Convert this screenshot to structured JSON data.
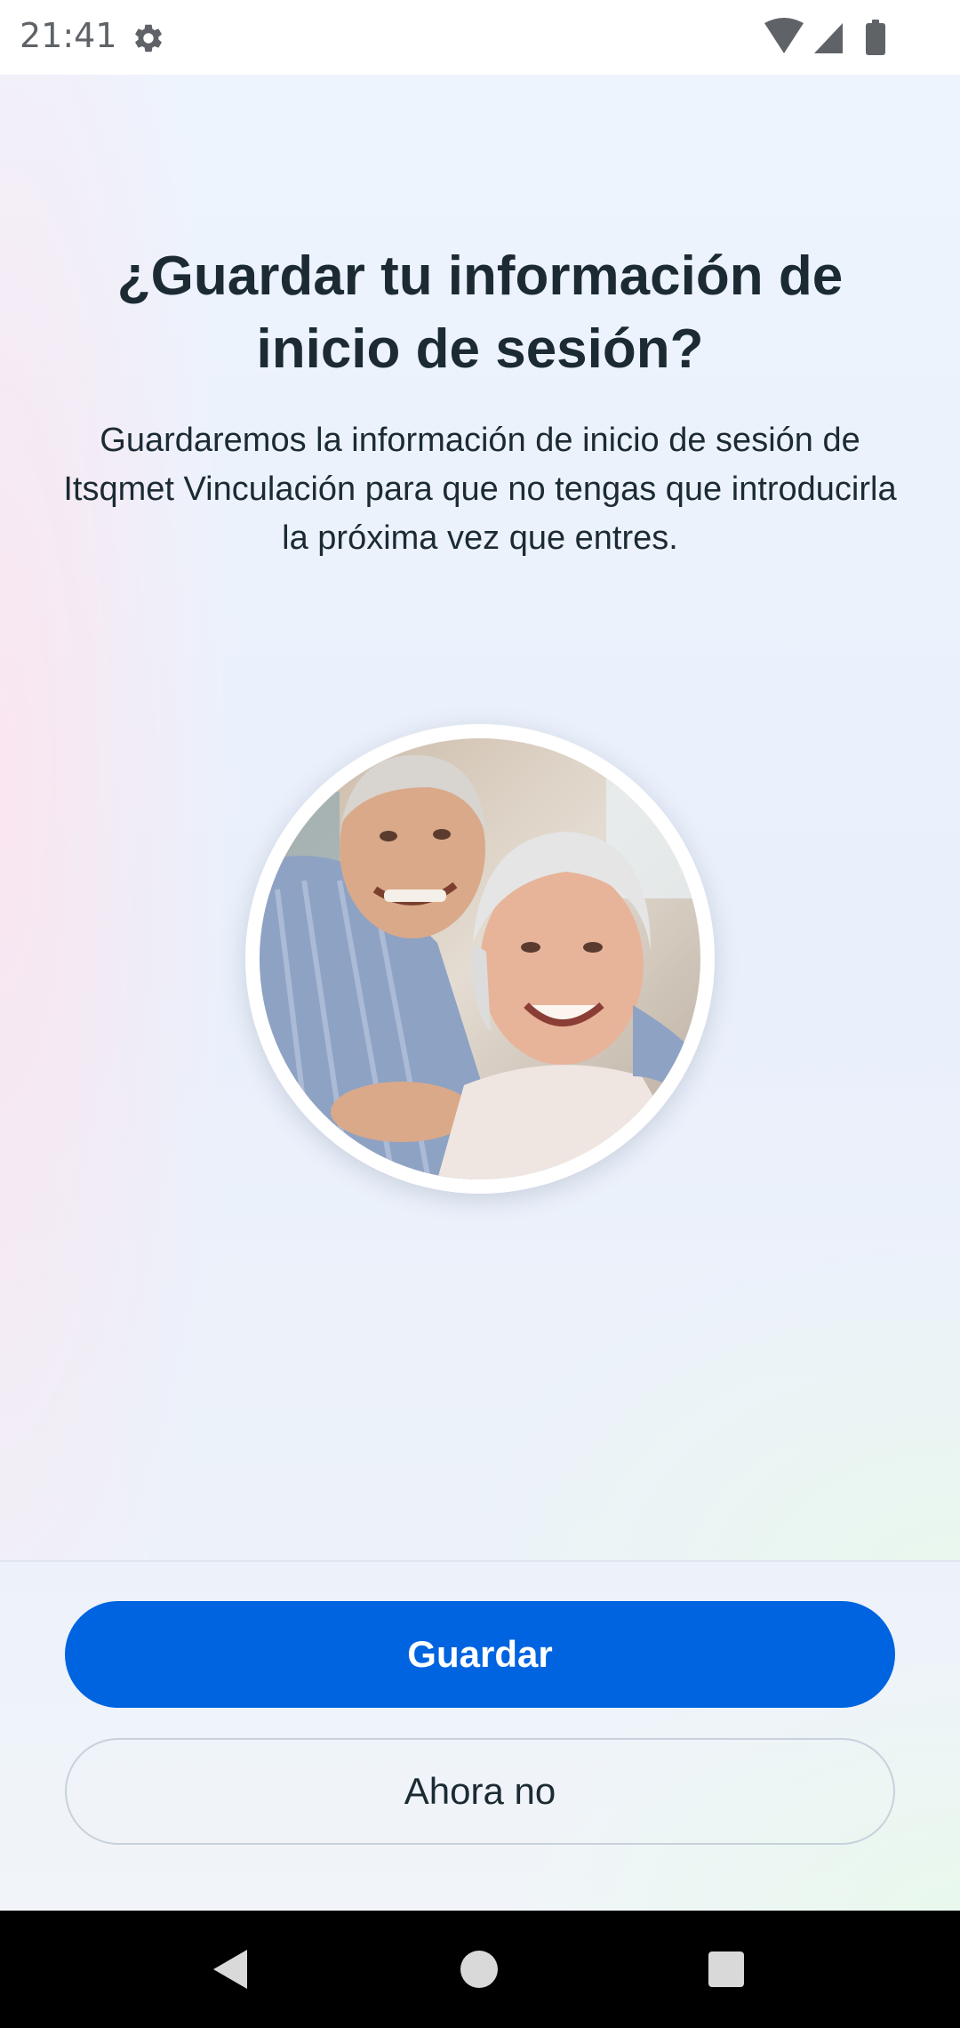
{
  "status_bar": {
    "time": "21:41",
    "icons": [
      "gear-icon",
      "wifi-icon",
      "cellular-signal-icon",
      "battery-icon"
    ]
  },
  "dialog": {
    "title": "¿Guardar tu información de inicio de sesión?",
    "description": "Guardaremos la información de inicio de sesión de Itsqmet Vinculación para que no tengas que introducirla la próxima vez que entres.",
    "profile_image": "elderly-couple-photo"
  },
  "actions": {
    "save_label": "Guardar",
    "not_now_label": "Ahora no"
  },
  "colors": {
    "primary": "#0064e0",
    "text": "#1c2b33",
    "secondary_border": "#c8d1dc"
  },
  "nav_bar": {
    "icons": [
      "back-icon",
      "home-icon",
      "recent-apps-icon"
    ]
  }
}
